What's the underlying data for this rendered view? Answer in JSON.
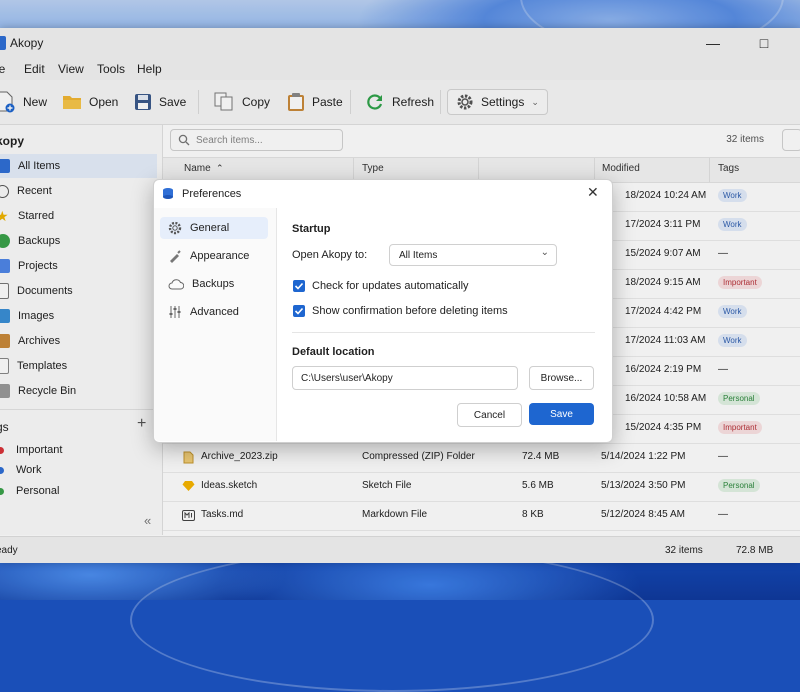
{
  "app": {
    "title": "Akopy"
  },
  "menu": [
    "le",
    "Edit",
    "View",
    "Tools",
    "Help"
  ],
  "toolbar": {
    "new": "New",
    "open": "Open",
    "save": "Save",
    "copy": "Copy",
    "paste": "Paste",
    "refresh": "Refresh",
    "settings": "Settings"
  },
  "sidebar": {
    "heading": "kopy",
    "items": [
      "All Items",
      "Recent",
      "Starred",
      "Backups",
      "Projects",
      "Documents",
      "Images",
      "Archives",
      "Templates",
      "Recycle Bin"
    ],
    "tags_heading": "gs",
    "tags": [
      {
        "label": "Important",
        "color": "#d9343a"
      },
      {
        "label": "Work",
        "color": "#2f6fd6"
      },
      {
        "label": "Personal",
        "color": "#3aa24a"
      }
    ]
  },
  "content": {
    "search_placeholder": "Search items...",
    "count": "32 items",
    "columns": {
      "name": "Name",
      "type": "Type",
      "modified": "Modified",
      "tags": "Tags"
    },
    "rows": [
      {
        "modified": "18/2024 10:24 AM",
        "tag": "Work"
      },
      {
        "modified": "17/2024 3:11 PM",
        "tag": "Work"
      },
      {
        "modified": "15/2024 9:07 AM",
        "tag": "—"
      },
      {
        "modified": "18/2024 9:15 AM",
        "tag": "Important"
      },
      {
        "modified": "17/2024 4:42 PM",
        "tag": "Work"
      },
      {
        "modified": "17/2024 11:03 AM",
        "tag": "Work"
      },
      {
        "modified": "16/2024 2:19 PM",
        "tag": "—"
      },
      {
        "modified": "16/2024 10:58 AM",
        "tag": "Personal"
      },
      {
        "modified": "15/2024 4:35 PM",
        "tag": "Important"
      },
      {
        "name": "Archive_2023.zip",
        "type": "Compressed (ZIP) Folder",
        "size": "72.4 MB",
        "modified": "5/14/2024 1:22 PM",
        "tag": "—"
      },
      {
        "name": "Ideas.sketch",
        "type": "Sketch File",
        "size": "5.6 MB",
        "modified": "5/13/2024 3:50 PM",
        "tag": "Personal"
      },
      {
        "name": "Tasks.md",
        "type": "Markdown File",
        "size": "8 KB",
        "modified": "5/12/2024 8:45 AM",
        "tag": "—"
      }
    ]
  },
  "status": {
    "left": "eady",
    "count": "32 items",
    "size": "72.8 MB"
  },
  "dialog": {
    "title": "Preferences",
    "nav": [
      "General",
      "Appearance",
      "Backups",
      "Advanced"
    ],
    "section_startup": "Startup",
    "open_to_label": "Open Akopy to:",
    "open_to_value": "All Items",
    "check_updates": "Check for updates automatically",
    "confirm_delete": "Show confirmation before deleting items",
    "section_location": "Default location",
    "location_value": "C:\\Users\\user\\Akopy",
    "browse": "Browse...",
    "cancel": "Cancel",
    "save": "Save"
  },
  "colors": {
    "accent": "#1e66d0",
    "work_bg": "#e3ecfb",
    "important_bg": "#fbe3e4",
    "personal_bg": "#e2f3e4"
  }
}
